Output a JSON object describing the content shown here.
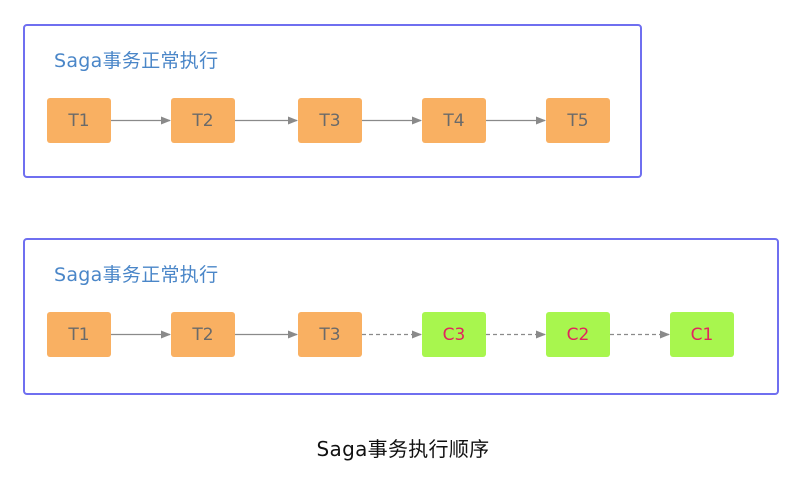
{
  "diagrams": [
    {
      "title": "Saga事务正常执行",
      "steps": [
        {
          "label": "T1",
          "kind": "transaction"
        },
        {
          "label": "T2",
          "kind": "transaction"
        },
        {
          "label": "T3",
          "kind": "transaction"
        },
        {
          "label": "T4",
          "kind": "transaction"
        },
        {
          "label": "T5",
          "kind": "transaction"
        }
      ],
      "connectors": [
        "solid",
        "solid",
        "solid",
        "solid"
      ]
    },
    {
      "title": "Saga事务正常执行",
      "steps": [
        {
          "label": "T1",
          "kind": "transaction"
        },
        {
          "label": "T2",
          "kind": "transaction"
        },
        {
          "label": "T3",
          "kind": "transaction"
        },
        {
          "label": "C3",
          "kind": "compensation"
        },
        {
          "label": "C2",
          "kind": "compensation"
        },
        {
          "label": "C1",
          "kind": "compensation"
        }
      ],
      "connectors": [
        "solid",
        "solid",
        "dashed",
        "dashed",
        "dashed"
      ]
    }
  ],
  "caption": "Saga事务执行顺序",
  "colors": {
    "panel_border": "#6f6ff0",
    "title_text": "#4a86c8",
    "transaction_fill": "#f9b062",
    "transaction_text": "#6a6a6a",
    "compensation_fill": "#a8f64e",
    "compensation_text": "#e2245e",
    "arrow": "#8a8a8a"
  }
}
